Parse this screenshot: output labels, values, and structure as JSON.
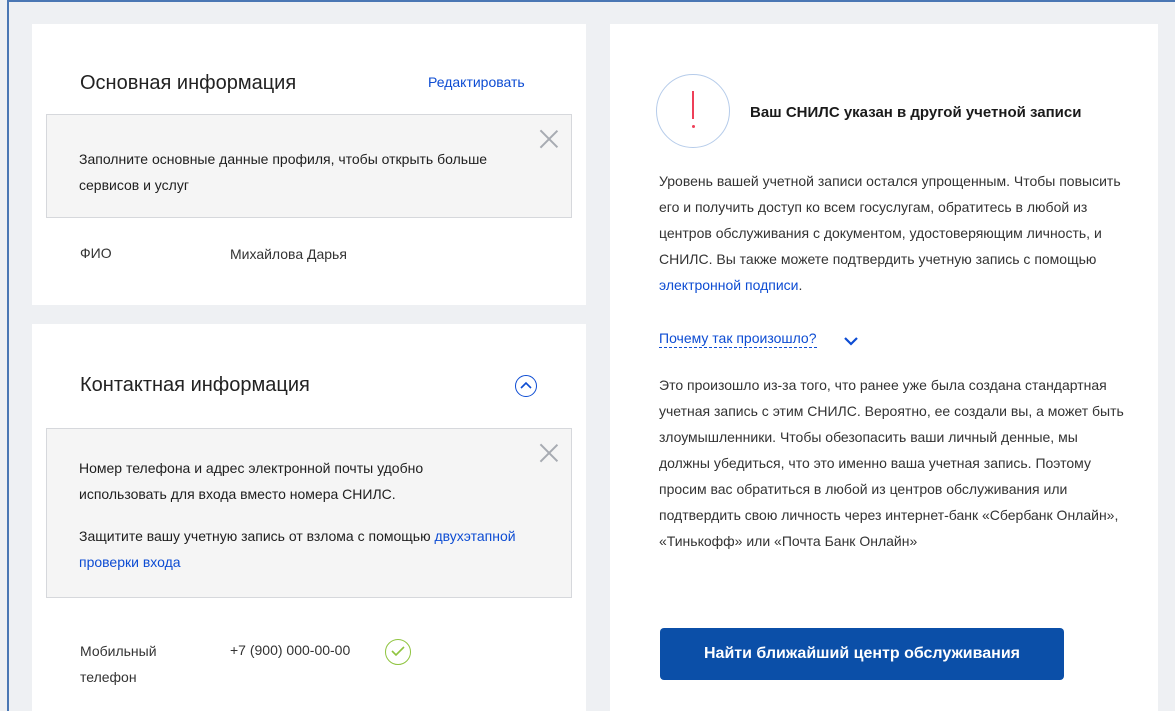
{
  "basic_info": {
    "title": "Основная информация",
    "edit_label": "Редактировать",
    "notice_text": "Заполните основные данные профиля, чтобы открыть больше сервисов и услуг",
    "fio_label": "ФИО",
    "fio_value": "Михайлова Дарья"
  },
  "contact_info": {
    "title": "Контактная информация",
    "notice_line1": "Номер телефона и адрес электронной почты удобно использовать для входа вместо номера СНИЛС.",
    "notice_line2_prefix": "Защитите вашу учетную запись от взлома с помощью",
    "notice_link": "двухэтапной проверки входа",
    "phone_label": "Мобильный телефон",
    "phone_value": "+7 (900) 000-00-00"
  },
  "snils_warning": {
    "title": "Ваш СНИЛС указан в другой учетной записи",
    "paragraph1": "Уровень вашей учетной записи остался упрощенным. Чтобы повысить его и получить доступ ко всем госуслугам, обратитесь в любой из центров обслуживания с документом, удостоверяющим личность, и СНИЛС. Вы также можете подтвердить учетную запись с помощью",
    "paragraph1_link": "электронной подписи",
    "paragraph1_end": ".",
    "why_link": "Почему так произошло?",
    "paragraph2": "Это произошло из-за того, что ранее уже была создана стандартная учетная запись с этим СНИЛС. Вероятно, ее создали вы, а может быть злоумышленники. Чтобы обезопасить ваши личный денные, мы должны убедиться, что это именно ваша учетная запись. Поэтому просим вас обратиться в любой из центров обслуживания или подтвердить свою личность через интернет-банк «Сбербанк Онлайн», «Тинькофф» или «Почта Банк Онлайн»",
    "cta_label": "Найти ближайший центр обслуживания"
  },
  "icons": {
    "close": "close-icon",
    "collapse": "chevron-up-icon",
    "check": "check-circle-icon",
    "alert": "exclamation-icon",
    "why_chevron": "chevron-down-icon"
  },
  "colors": {
    "link": "#0d4cd3",
    "button": "#0b4fa8",
    "alert": "#ee3f58",
    "success": "#8fc43f"
  }
}
